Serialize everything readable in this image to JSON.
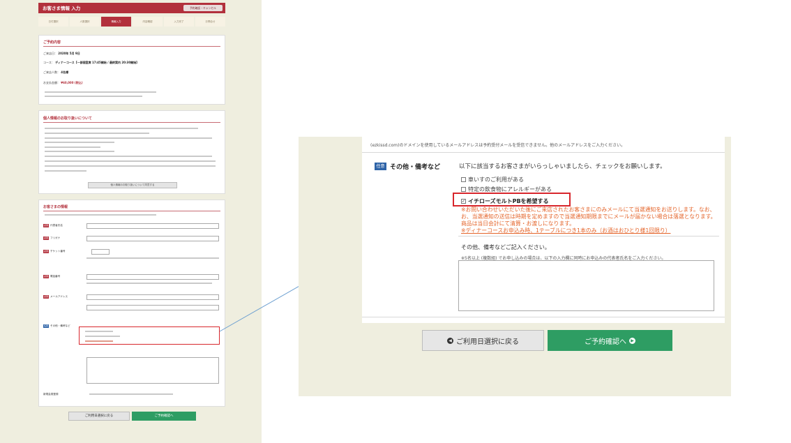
{
  "left_page": {
    "header_title": "お客さま情報 入力",
    "header_button": "予約確認・キャンセル",
    "steps": [
      "日付選択",
      "人数選択",
      "情報入力",
      "内容確認",
      "入力完了",
      "お問合せ"
    ],
    "reservation": {
      "heading": "ご予約内容",
      "rows": [
        {
          "label": "ご来店日：",
          "value": "2020年 5月 9日"
        },
        {
          "label": "コース：",
          "value": "ディナーコース【一部個室席 17:45開始 / 最終案内 20:30開始】"
        },
        {
          "label": "ご来店人数：",
          "value": "4名様"
        }
      ],
      "price_label": "お支払金額：",
      "price_value": "¥60,000 (税込)"
    },
    "privacy": {
      "heading": "個人情報のお取り扱いについて",
      "button": "個人情報のお取り扱いについて同意する"
    },
    "customer": {
      "heading": "お客さまの情報",
      "fields": [
        {
          "badge": "必須",
          "label": "代表者氏名"
        },
        {
          "badge": "必須",
          "label": "フリガナ"
        },
        {
          "badge": "必須",
          "label": "チケット番号"
        },
        {
          "badge": "必須",
          "label": "電話番号"
        },
        {
          "badge": "必須",
          "label": "メールアドレス"
        },
        {
          "badge": "任意",
          "label": "その他・備考など"
        }
      ],
      "last_label": "新規会員登録"
    },
    "back_button": "ご利用日選択に戻る",
    "next_button": "ご予約確認へ"
  },
  "zoom": {
    "top_note": "(ezkissd.com)のドメインを使用しているメールアドレスは予約受付メールを受信できません。他のメールアドレスをご入力ください。",
    "field_badge": "任意",
    "field_label": "その他・備考など",
    "instruction": "以下に該当するお客さまがいらっしゃいましたら、チェックをお願いします。",
    "checkboxes": [
      {
        "label": "車いすのご利用がある",
        "checked": false
      },
      {
        "label": "特定の飲食物にアレルギーがある",
        "checked": false
      },
      {
        "label": "イチローズモルトPBを希望する",
        "checked": true
      }
    ],
    "notes": [
      "※お問い合わせいただいた後にご来店されたお客さまにのみメールにて当選通知をお送りします。なお、",
      "お、当選通知の送信は時期を定めますので当選通知期限までにメールが届かない場合は落選となります。",
      "商品は当日会計にて清算・お渡しになります。",
      "※ディナーコースお申込み時、1テーブルにつき1本のみ（お酒はおひとり様1回限り）"
    ],
    "memo_title": "その他、備考などご記入ください。",
    "memo_hint": "※5名以上 (複数組) でお申し込みの場合は、以下の入力欄に同時にお申込みの代表者氏名をご入力ください。",
    "back_button": "ご利用日選択に戻る",
    "next_button": "ご予約確認へ"
  },
  "colors": {
    "brand": "#b2303c",
    "accent_green": "#2e9d63",
    "optional_blue": "#2e63a7",
    "highlight_red": "#d8262c",
    "note_orange": "#e4642a",
    "page_bg": "#efeedf"
  }
}
